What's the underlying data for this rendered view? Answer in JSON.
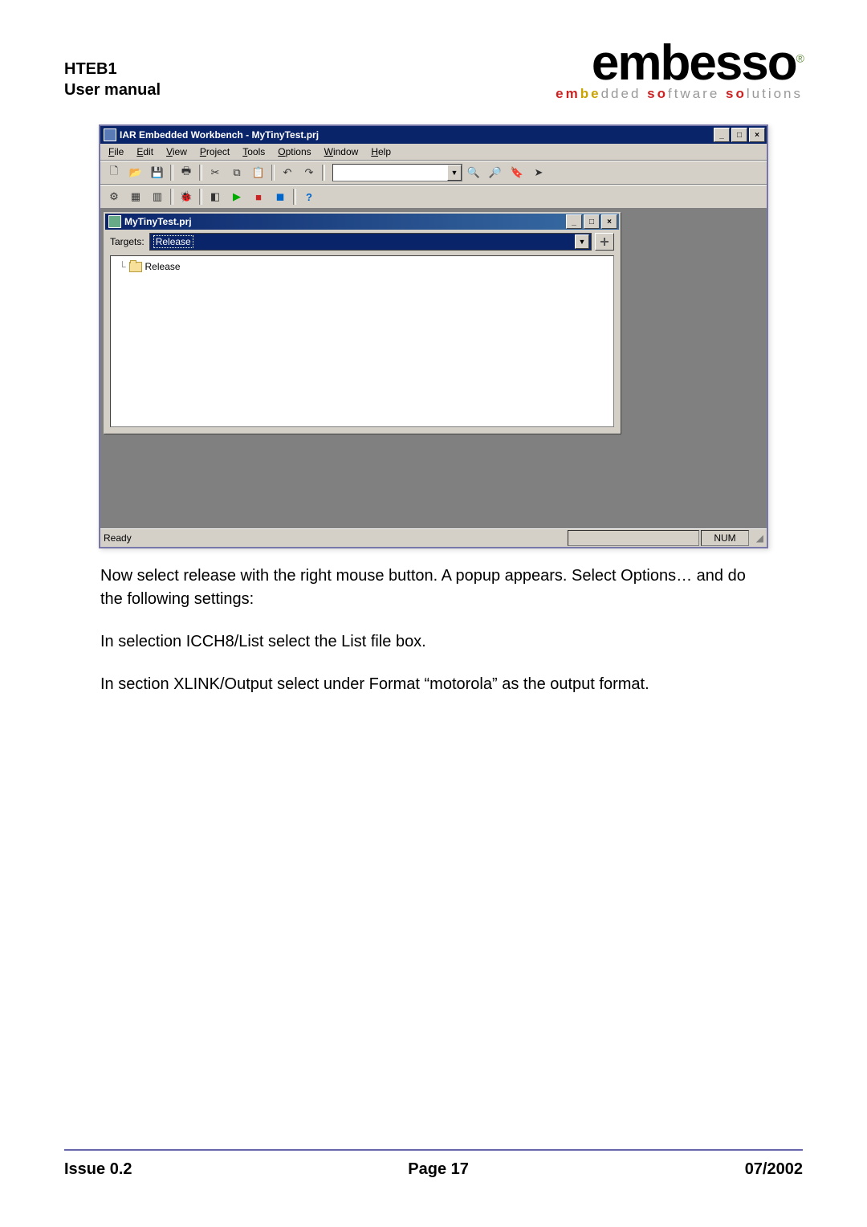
{
  "doc": {
    "header_line1": "HTEB1",
    "header_line2": "User manual",
    "logo_main": "embesso",
    "logo_sub_parts": [
      "em",
      "be",
      "dded ",
      "so",
      "ftware ",
      "so",
      "lutions"
    ]
  },
  "app": {
    "title": "IAR Embedded Workbench - MyTinyTest.prj",
    "menus": [
      "File",
      "Edit",
      "View",
      "Project",
      "Tools",
      "Options",
      "Window",
      "Help"
    ],
    "child_title": "MyTinyTest.prj",
    "targets_label": "Targets:",
    "targets_value": "Release",
    "tree_root": "Release",
    "status_ready": "Ready",
    "status_num": "NUM"
  },
  "body": {
    "p1": "Now select release with the right mouse button. A popup appears. Select Options… and do the following settings:",
    "p2": "In selection ICCH8/List select the List file box.",
    "p3": "In section XLINK/Output select under Format “motorola” as the output format."
  },
  "footer": {
    "left": "Issue 0.2",
    "center": "Page 17",
    "right": "07/2002"
  }
}
